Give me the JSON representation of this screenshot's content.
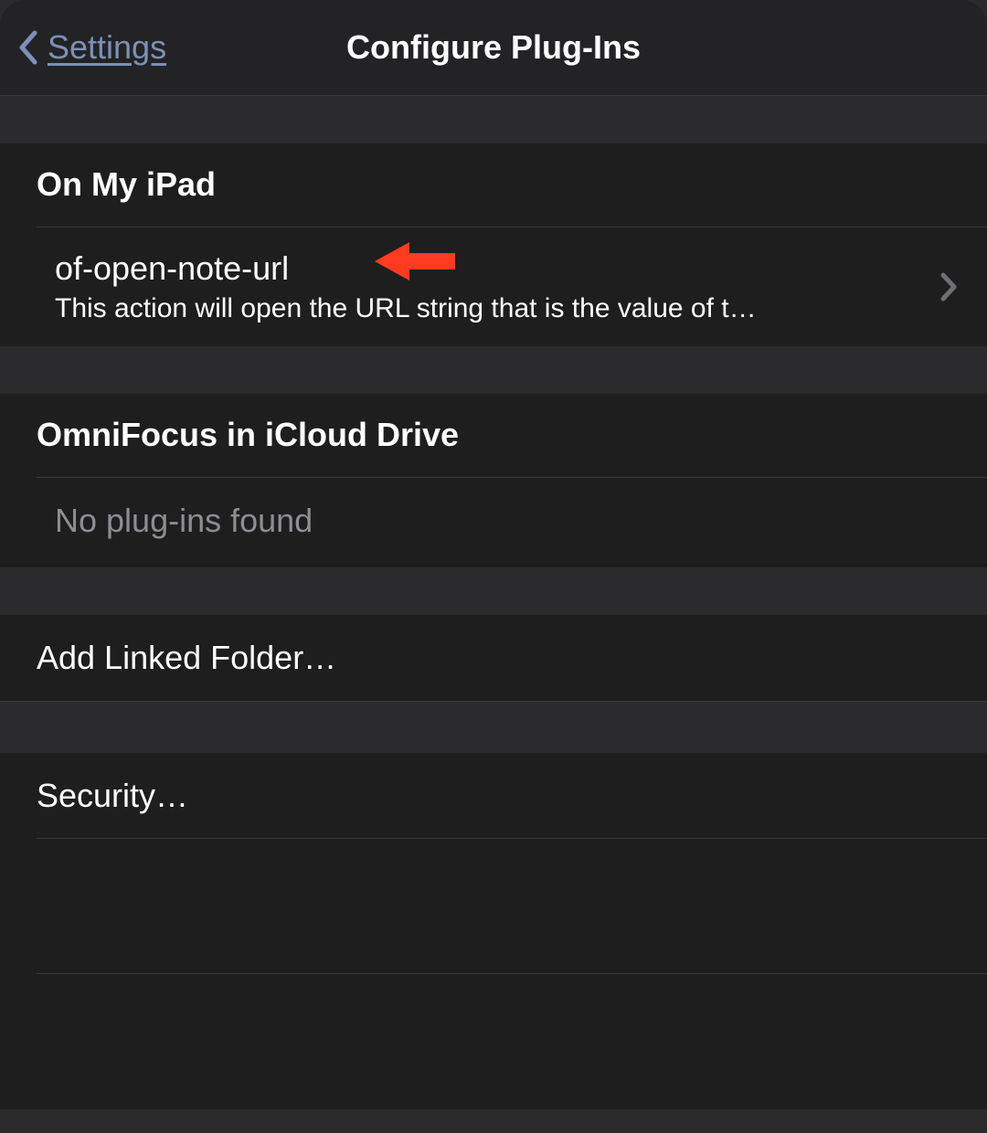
{
  "header": {
    "back_label": "Settings",
    "title": "Configure Plug-Ins"
  },
  "sections": {
    "on_my_ipad": {
      "title": "On My iPad",
      "plugins": [
        {
          "name": "of-open-note-url",
          "description": "This action will open the URL string that is the value of t…"
        }
      ]
    },
    "icloud": {
      "title": "OmniFocus in iCloud Drive",
      "empty_text": "No plug-ins found"
    }
  },
  "actions": {
    "add_linked_folder": "Add Linked Folder…",
    "security": "Security…"
  },
  "colors": {
    "accent_link": "#7b91b8",
    "annotation_arrow": "#ff3a1f"
  }
}
